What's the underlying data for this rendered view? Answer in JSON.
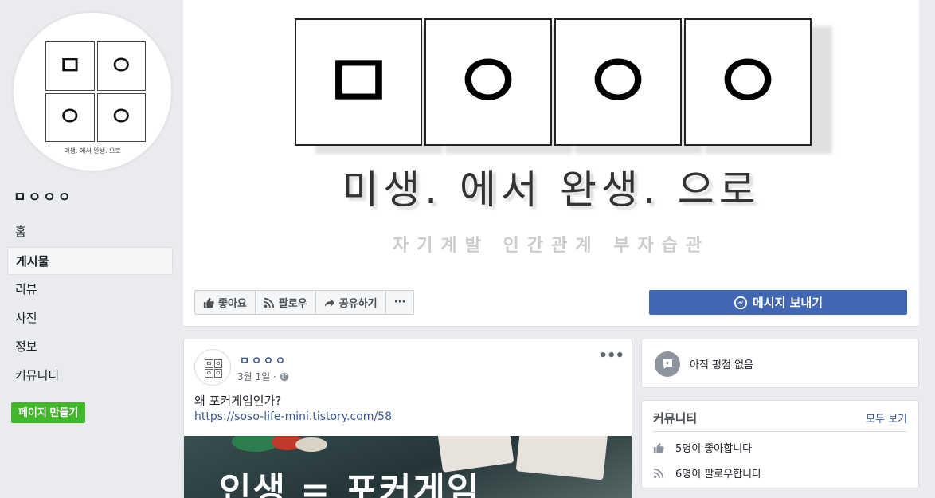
{
  "sidebar": {
    "logo_chars": [
      "ㅁ",
      "ㅇ",
      "ㅇ",
      "ㅇ"
    ],
    "logo_tagline": "미생. 에서 완생. 으로",
    "page_name": "ㅁㅇㅇㅇ",
    "nav": [
      {
        "label": "홈"
      },
      {
        "label": "게시물"
      },
      {
        "label": "리뷰"
      },
      {
        "label": "사진"
      },
      {
        "label": "정보"
      },
      {
        "label": "커뮤니티"
      }
    ],
    "create_page_label": "페이지 만들기"
  },
  "cover": {
    "chars": [
      "ㅁ",
      "ㅇ",
      "ㅇ",
      "ㅇ"
    ],
    "title": "미생. 에서 완생. 으로",
    "subtitle": "자기계발 인간관계 부자습관"
  },
  "actions": {
    "like_label": "좋아요",
    "follow_label": "팔로우",
    "share_label": "공유하기",
    "more_label": "···",
    "message_label": "메시지 보내기"
  },
  "post": {
    "author": "ㅁㅇㅇㅇ",
    "date": "3월 1일 ·",
    "text": "왜 포커게임인가?",
    "link": "https://soso-life-mini.tistory.com/58",
    "image_text": "인생 = 포커게임",
    "more_label": "•••"
  },
  "reviews": {
    "text": "아직 평점 없음"
  },
  "community": {
    "title": "커뮤니티",
    "see_all": "모두 보기",
    "likes_text": "5명이 좋아합니다",
    "follows_text": "6명이 팔로우합니다"
  },
  "colors": {
    "accent": "#4267b2",
    "create_button": "#42b72a",
    "link": "#385898",
    "background": "#e9ebee"
  }
}
